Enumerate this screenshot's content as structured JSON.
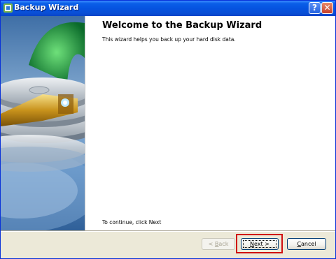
{
  "window": {
    "title": "Backup Wizard"
  },
  "titlebar_buttons": {
    "help": "?",
    "close": "✕"
  },
  "content": {
    "heading": "Welcome to the Backup Wizard",
    "description": "This wizard helps you back up your hard disk data.",
    "continue_text": "To continue, click Next"
  },
  "buttons": {
    "back_prefix": "< ",
    "back_key": "B",
    "back_rest": "ack",
    "next_key": "N",
    "next_rest": "ext >",
    "cancel_key": "C",
    "cancel_rest": "ancel"
  },
  "colors": {
    "titlebar": "#0553e0",
    "dialog_background": "#ece9d8",
    "highlight_box": "#d01010"
  }
}
